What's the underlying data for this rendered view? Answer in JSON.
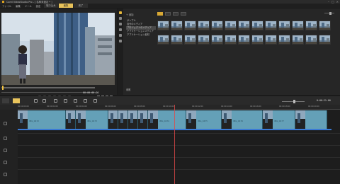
{
  "window": {
    "title": "Corel VideoStudio Pro - [ 名称未設定 * ]"
  },
  "menubar": {
    "items": [
      "ファイル",
      "編集",
      "ツール",
      "設定"
    ],
    "modes": [
      {
        "label": "取り込み",
        "active": false
      },
      {
        "label": "編集",
        "active": true
      },
      {
        "label": "完了",
        "active": false
      }
    ]
  },
  "preview": {
    "project_label": "Project",
    "clip_label": "Clip",
    "timecode": "00:00:00:00"
  },
  "library": {
    "add_label": "+ 追加",
    "folders": [
      "サンプル",
      "自分のメディア",
      "プロジェクトのメディア",
      "アプリケーションメディア",
      "アプリケーション素材"
    ],
    "selected_folder_index": 2,
    "browse_label": "参照",
    "thumbnail_count": 26
  },
  "timeline": {
    "timecode": "0:00:21:00",
    "ruler_ticks": [
      "00:00:00:00",
      "00:00:02:00",
      "00:00:04:00",
      "00:00:06:00",
      "00:00:08:00",
      "00:00:10:00",
      "00:00:12:00",
      "00:00:14:00",
      "00:00:16:00",
      "00:00:18:00",
      "00:00:20:00"
    ],
    "clips": [
      {
        "name": "IMG_0472",
        "has_label": true
      },
      {
        "name": "",
        "has_label": false
      },
      {
        "name": "IMG_0473",
        "has_label": true
      },
      {
        "name": "",
        "has_label": false
      },
      {
        "name": "",
        "has_label": false
      },
      {
        "name": "",
        "has_label": false
      },
      {
        "name": "",
        "has_label": false
      },
      {
        "name": "IMG_0474",
        "has_label": true
      },
      {
        "name": "IMG_0475",
        "has_label": true
      },
      {
        "name": "IMG_0476",
        "has_label": true
      },
      {
        "name": "IMG_0477",
        "has_label": true
      },
      {
        "name": "",
        "has_label": false
      }
    ]
  },
  "colors": {
    "accent": "#e9c45c",
    "clip": "#64a0b7",
    "playhead": "#e04848",
    "selection_line": "#3a7ad6"
  }
}
